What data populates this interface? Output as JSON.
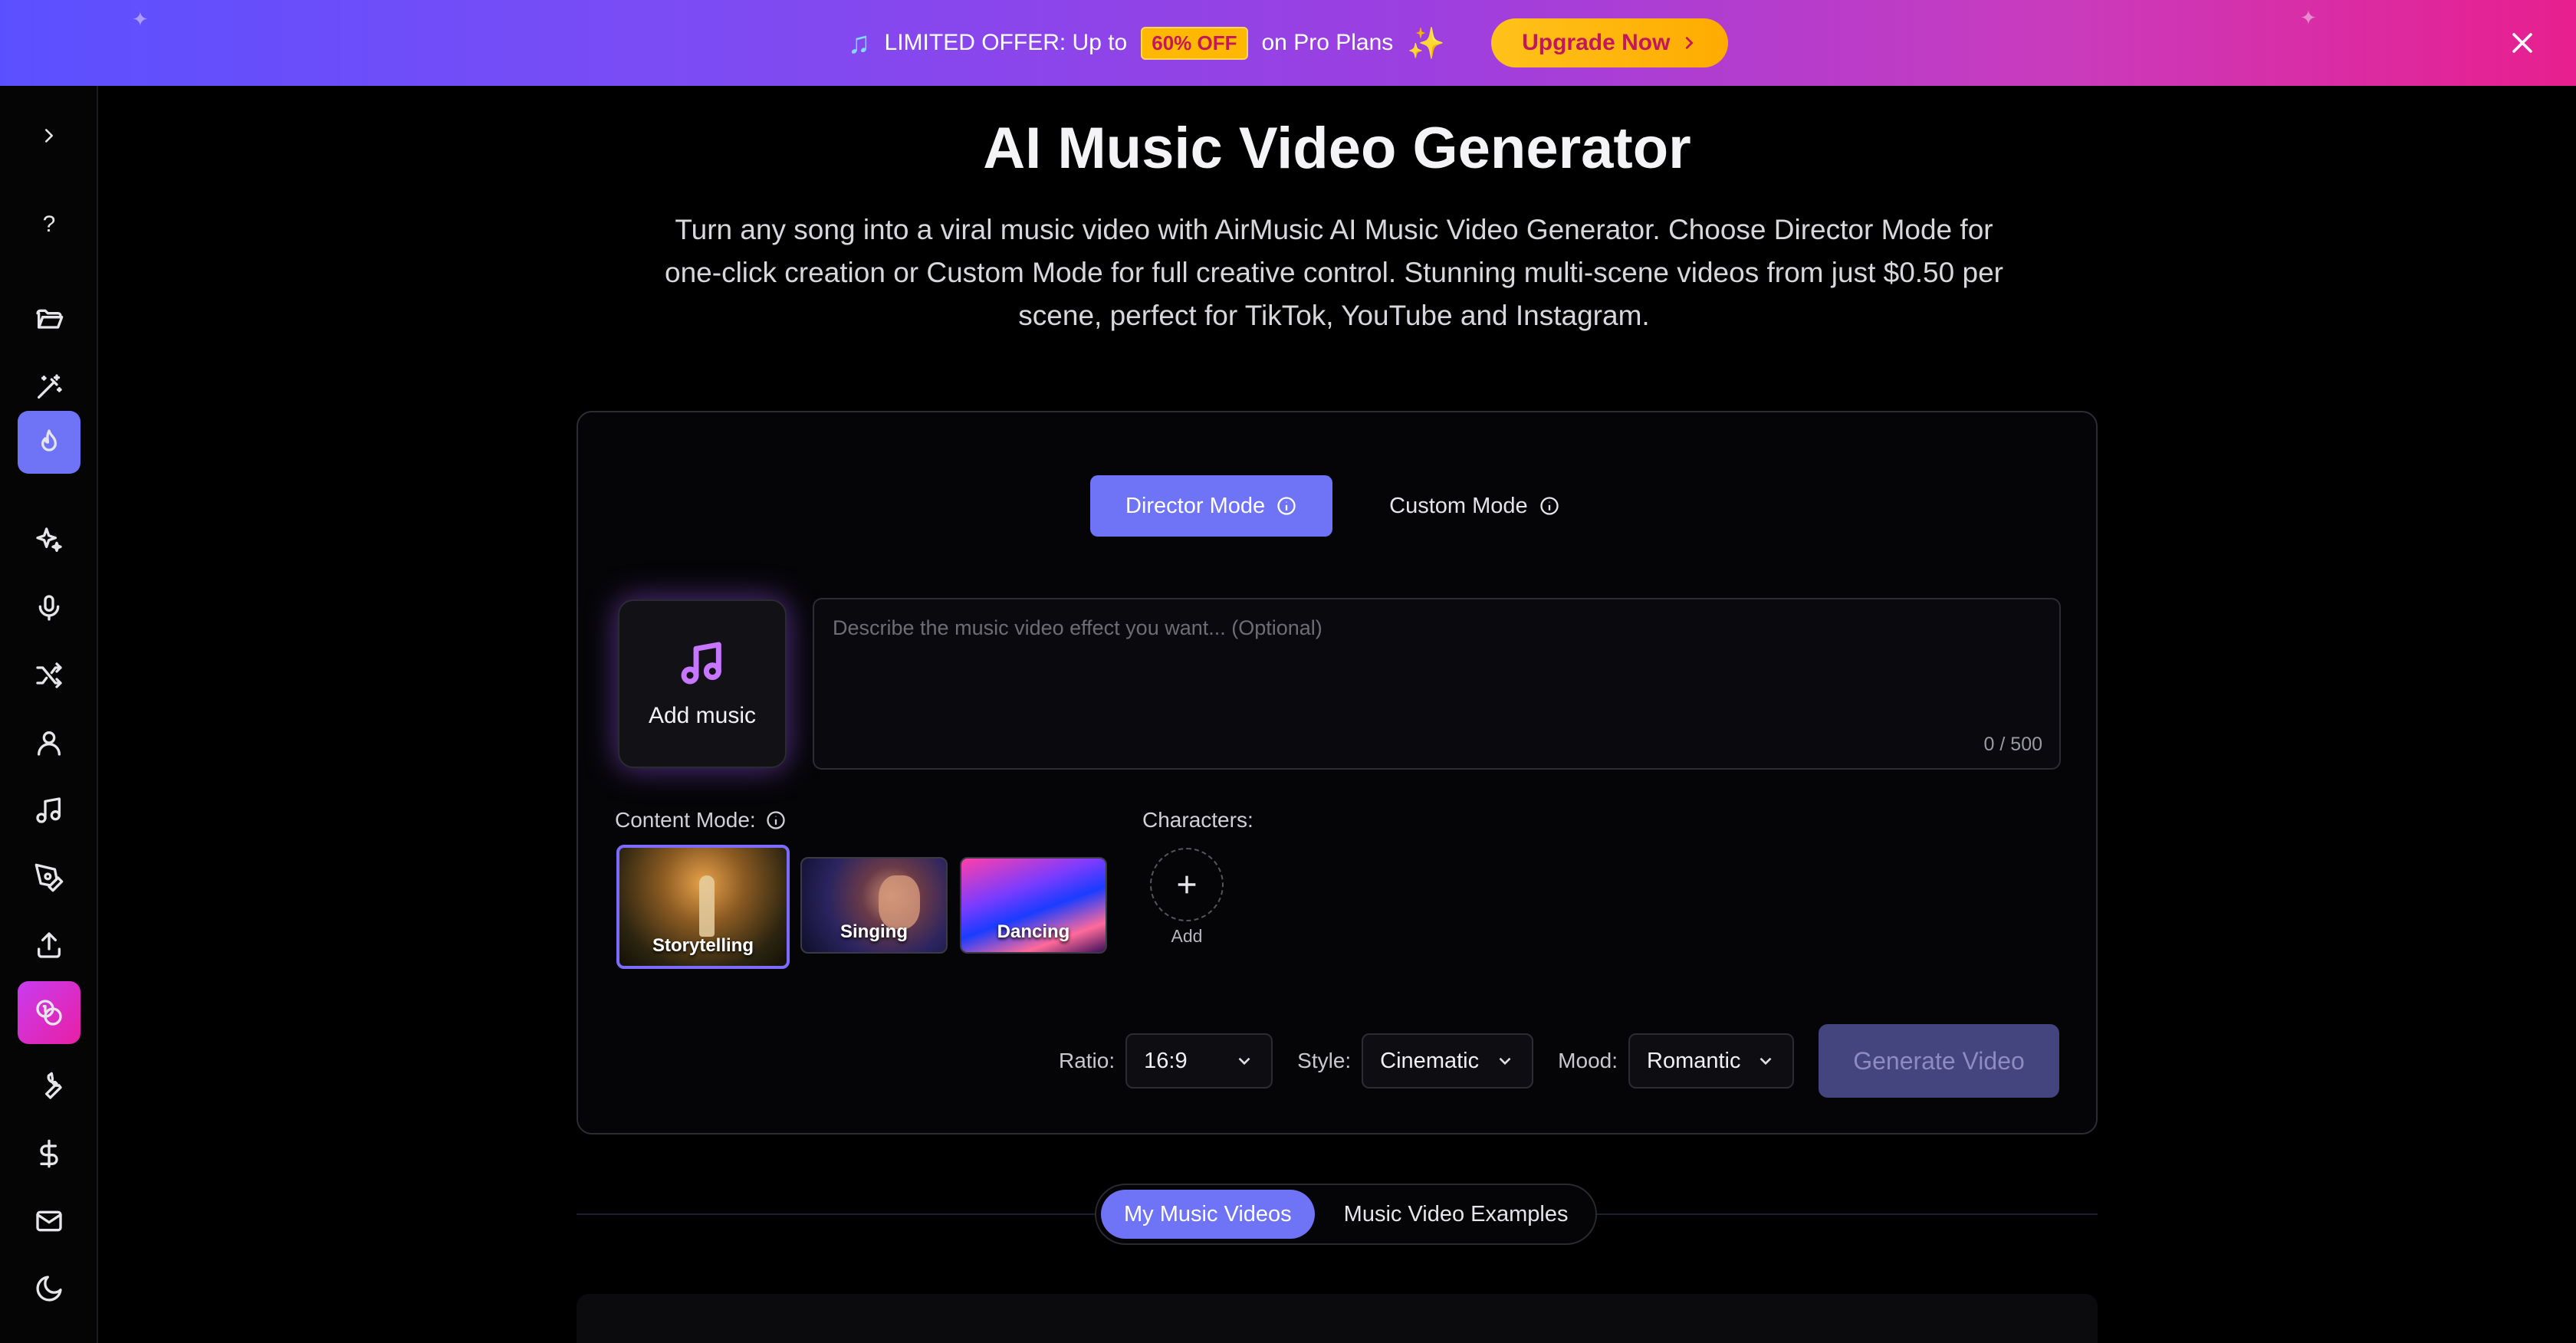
{
  "banner": {
    "offer_prefix": "LIMITED OFFER: Up to",
    "discount_badge": "60% OFF",
    "offer_suffix": "on Pro Plans",
    "upgrade_label": "Upgrade Now",
    "note_icon": "music-note-icon",
    "sparkle_icon": "sparkles-icon",
    "gradient_colors": [
      "#5b50ff",
      "#9c3fe0",
      "#e81f8e"
    ]
  },
  "sidebar": {
    "items": [
      {
        "name": "expand",
        "icon": "chevron-right-icon"
      },
      {
        "name": "help",
        "icon": "help-icon",
        "text": "?"
      },
      {
        "name": "folder",
        "icon": "folder-icon"
      },
      {
        "name": "magic",
        "icon": "magic-wand-icon"
      },
      {
        "name": "hot",
        "icon": "flame-icon",
        "active": true
      },
      {
        "name": "sparkles",
        "icon": "sparkles-icon"
      },
      {
        "name": "microphone",
        "icon": "microphone-icon"
      },
      {
        "name": "shuffle",
        "icon": "shuffle-icon"
      },
      {
        "name": "user",
        "icon": "user-icon"
      },
      {
        "name": "music",
        "icon": "music-icon"
      },
      {
        "name": "pen",
        "icon": "pen-icon"
      },
      {
        "name": "upload",
        "icon": "upload-icon"
      },
      {
        "name": "video-generator",
        "icon": "coins-icon",
        "active": true
      },
      {
        "name": "tools",
        "icon": "wrench-icon"
      },
      {
        "name": "pricing",
        "icon": "dollar-icon"
      },
      {
        "name": "contact",
        "icon": "mail-icon"
      },
      {
        "name": "theme",
        "icon": "moon-icon"
      }
    ],
    "accent_color": "#6f73f5",
    "highlight_color": "#e81fa4"
  },
  "page": {
    "title": "AI Music Video Generator",
    "subtitle": "Turn any song into a viral music video with AirMusic AI Music Video Generator. Choose Director Mode for one-click creation or Custom Mode for full creative control. Stunning multi-scene videos from just $0.50 per scene, perfect for TikTok, YouTube and Instagram."
  },
  "generator": {
    "mode_tabs": [
      {
        "label": "Director Mode",
        "active": true
      },
      {
        "label": "Custom Mode",
        "active": false
      }
    ],
    "add_music_label": "Add music",
    "prompt": {
      "placeholder": "Describe the music video effect you want... (Optional)",
      "value": "",
      "counter": "0 / 500"
    },
    "content_mode_label": "Content Mode:",
    "content_modes": [
      {
        "label": "Storytelling",
        "selected": true
      },
      {
        "label": "Singing",
        "selected": false
      },
      {
        "label": "Dancing",
        "selected": false
      }
    ],
    "characters_label": "Characters:",
    "add_character_label": "Add",
    "ratio": {
      "label": "Ratio:",
      "value": "16:9"
    },
    "style": {
      "label": "Style:",
      "value": "Cinematic"
    },
    "mood": {
      "label": "Mood:",
      "value": "Romantic"
    },
    "generate_label": "Generate Video"
  },
  "library_tabs": [
    {
      "label": "My Music Videos",
      "active": true
    },
    {
      "label": "Music Video Examples",
      "active": false
    }
  ]
}
